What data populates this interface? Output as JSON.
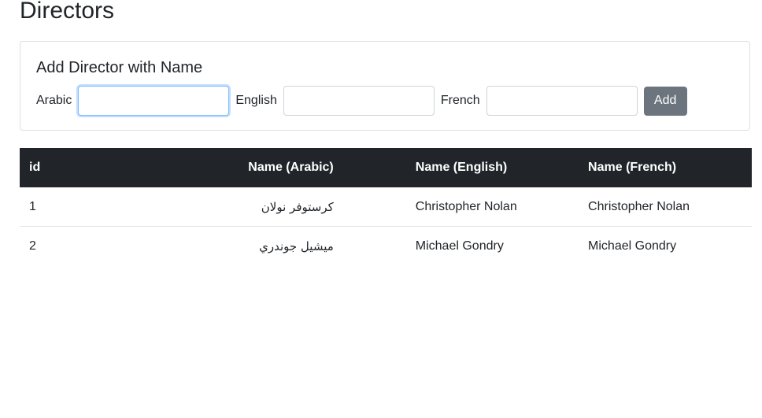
{
  "page": {
    "title": "Directors"
  },
  "form": {
    "title": "Add Director with Name",
    "arabic_label": "Arabic",
    "arabic_value": "",
    "english_label": "English",
    "english_value": "",
    "french_label": "French",
    "french_value": "",
    "add_label": "Add"
  },
  "table": {
    "headers": {
      "id": "id",
      "arabic": "Name (Arabic)",
      "english": "Name (English)",
      "french": "Name (French)"
    },
    "rows": [
      {
        "id": "1",
        "arabic": "كرستوفر نولان",
        "english": "Christopher Nolan",
        "french": "Christopher Nolan"
      },
      {
        "id": "2",
        "arabic": "ميشيل جوندري",
        "english": "Michael Gondry",
        "french": "Michael Gondry"
      }
    ]
  },
  "colors": {
    "header_bg": "#212529",
    "button_bg": "#6c757d",
    "focus_border": "#80bdff"
  }
}
